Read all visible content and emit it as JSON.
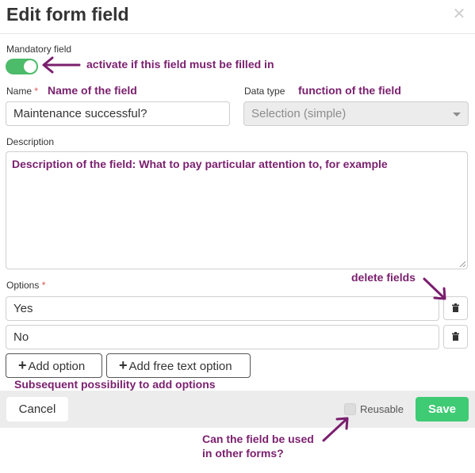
{
  "dialog": {
    "title": "Edit form field",
    "close_icon": "close-icon",
    "mandatory": {
      "label": "Mandatory field",
      "enabled": true
    },
    "name": {
      "label": "Name",
      "required_mark": "*",
      "value": "Maintenance successful?"
    },
    "data_type": {
      "label": "Data type",
      "value": "Selection (simple)",
      "disabled": true
    },
    "description": {
      "label": "Description",
      "value": ""
    },
    "options": {
      "label": "Options",
      "required_mark": "*",
      "items": [
        {
          "value": "Yes"
        },
        {
          "value": "No"
        }
      ],
      "add_option_label": "Add option",
      "add_free_text_label": "Add free text option"
    },
    "footer": {
      "cancel_label": "Cancel",
      "reusable_label": "Reusable",
      "reusable_checked": false,
      "save_label": "Save"
    }
  },
  "annotations": {
    "mandatory": "activate if this field must be filled in",
    "name": "Name of the field",
    "data_type": "function of the field",
    "description": "Description of the field: What to pay particular attention to, for example",
    "delete": "delete fields",
    "add_options": "Subsequent possibility to add options",
    "reusable_line1": "Can the field be used",
    "reusable_line2": "in other forms?"
  },
  "colors": {
    "annotation": "#7a1f6e",
    "toggle_on": "#4cbb6a",
    "save": "#3ecb74",
    "required": "#d9534f"
  }
}
